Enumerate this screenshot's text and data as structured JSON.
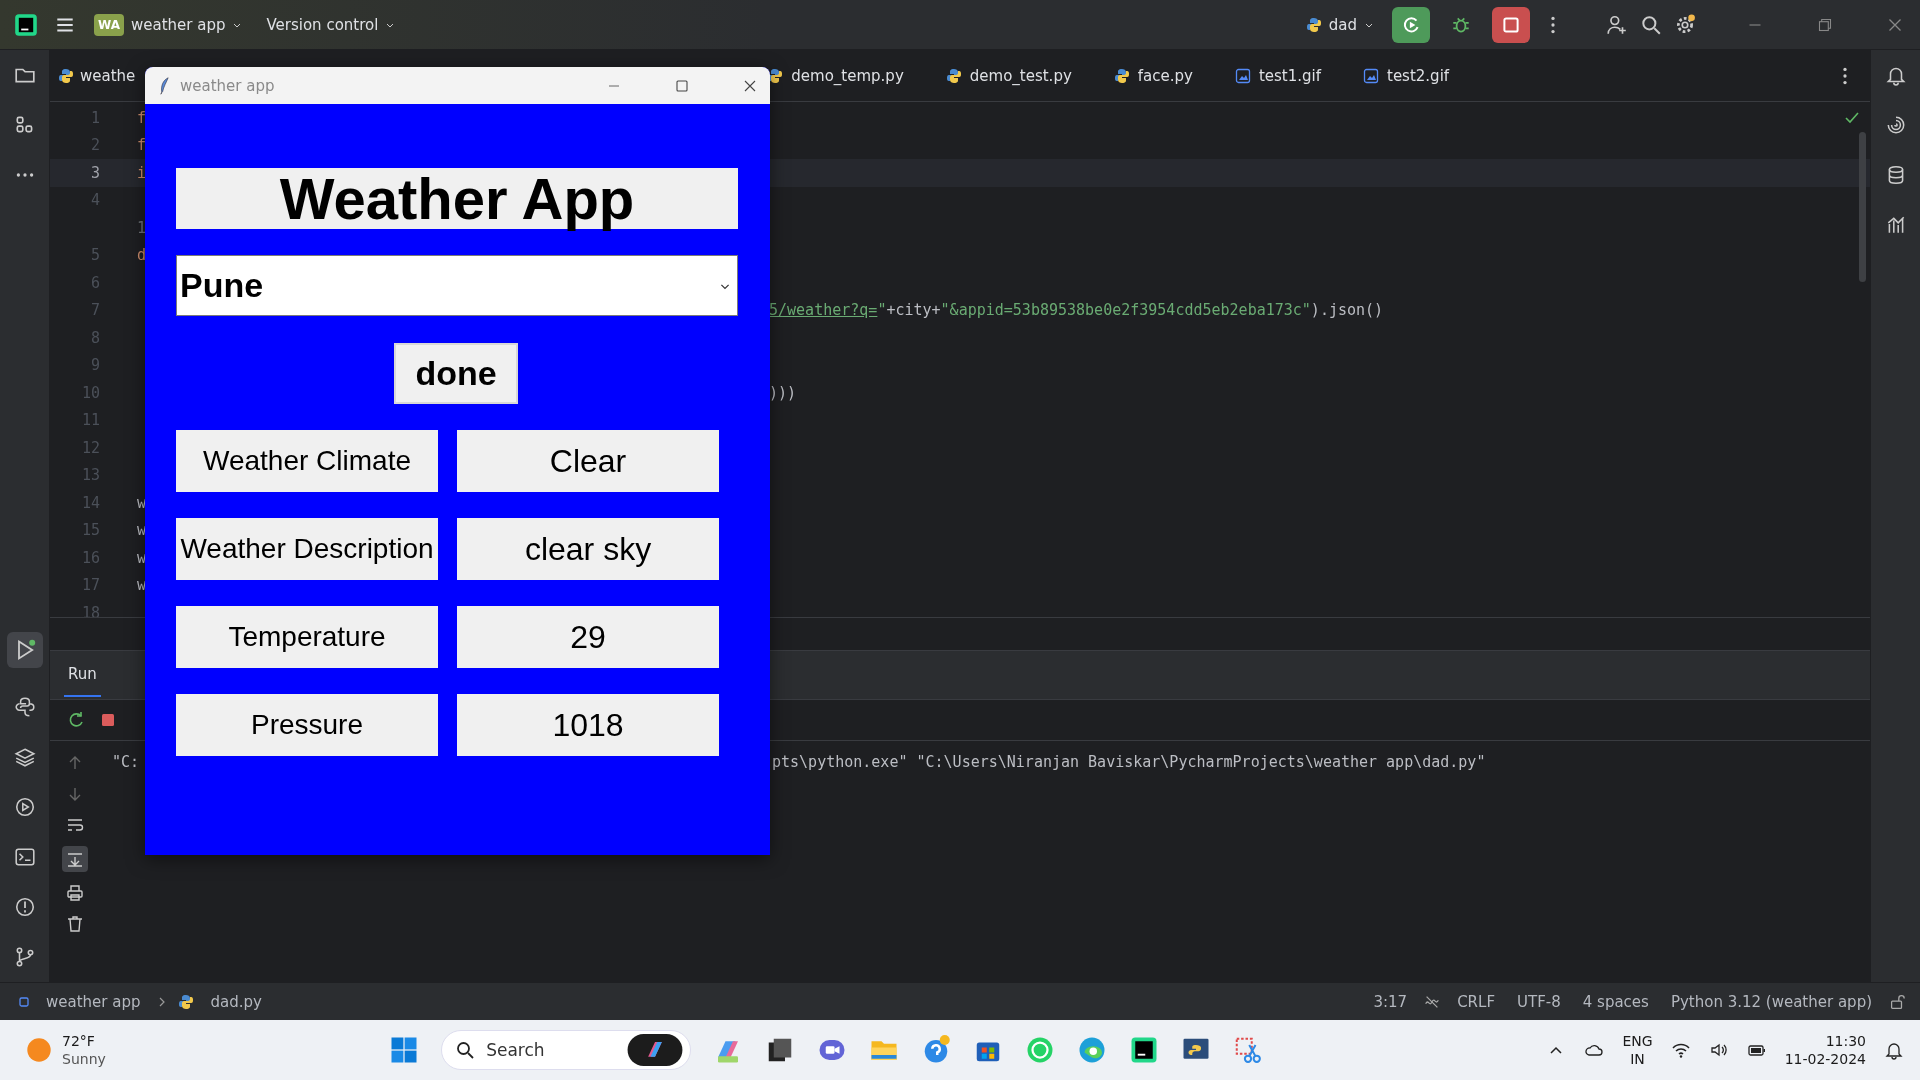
{
  "ide": {
    "project_badge": "WA",
    "project": "weather app",
    "vcs": "Version control",
    "run_config": "dad"
  },
  "tabs": [
    {
      "label": "weathe",
      "kind": "python",
      "selected": false
    },
    {
      "label": "demo_temp.py",
      "kind": "python",
      "selected": false
    },
    {
      "label": "demo_test.py",
      "kind": "python",
      "selected": false
    },
    {
      "label": "face.py",
      "kind": "python",
      "selected": false
    },
    {
      "label": "test1.gif",
      "kind": "image",
      "selected": false
    },
    {
      "label": "test2.gif",
      "kind": "image",
      "selected": false
    }
  ],
  "editor": {
    "lines": [
      {
        "number": "1",
        "left": {
          "text": "f",
          "kind": "keyword"
        },
        "selected": false
      },
      {
        "number": "2",
        "left": {
          "text": "f",
          "kind": "keyword"
        },
        "selected": false
      },
      {
        "number": "3",
        "left": {
          "text": "i",
          "kind": "keyword"
        },
        "selected": true
      },
      {
        "number": "4",
        "selected": false
      },
      {
        "left": {
          "text": "1",
          "kind": "hint"
        },
        "selected": false
      },
      {
        "number": "5",
        "left": {
          "text": "d",
          "kind": "keyword"
        },
        "selected": false
      },
      {
        "number": "6",
        "selected": false
      },
      {
        "number": "7",
        "selected": false,
        "right": [
          {
            "text": "5/weather?q=",
            "kind": "link"
          },
          {
            "text": "\"",
            "kind": "string"
          },
          {
            "text": "+city+",
            "kind": "plain"
          },
          {
            "text": "\"&appid=53b89538be0e2f3954cdd5eb2eba173c\"",
            "kind": "string"
          },
          {
            "text": ").json()",
            "kind": "plain"
          }
        ]
      },
      {
        "number": "8",
        "selected": false
      },
      {
        "number": "9",
        "selected": false
      },
      {
        "number": "10",
        "selected": false,
        "right": [
          {
            "text": ")))",
            "kind": "plain"
          }
        ]
      },
      {
        "number": "11",
        "selected": false
      },
      {
        "number": "12",
        "selected": false
      },
      {
        "number": "13",
        "selected": false
      },
      {
        "number": "14",
        "left": {
          "text": "w",
          "kind": "plain"
        },
        "selected": false
      },
      {
        "number": "15",
        "left": {
          "text": "w",
          "kind": "plain"
        },
        "selected": false
      },
      {
        "number": "16",
        "left": {
          "text": "w",
          "kind": "plain"
        },
        "selected": false
      },
      {
        "number": "17",
        "left": {
          "text": "w",
          "kind": "plain"
        },
        "selected": false
      },
      {
        "number": "18",
        "selected": false
      }
    ]
  },
  "run_panel": {
    "tab": "Run",
    "output": [
      {
        "left": "\"C:",
        "right": "pts\\python.exe\" \"C:\\Users\\Niranjan Baviskar\\PycharmProjects\\weather app\\dad.py\""
      }
    ]
  },
  "status_bar": {
    "breadcrumb": [
      "weather app",
      "dad.py"
    ],
    "position": "3:17",
    "line_separator": "CRLF",
    "encoding": "UTF-8",
    "indent": "4 spaces",
    "interpreter": "Python 3.12 (weather app)"
  },
  "tk_window": {
    "title": "weather app",
    "heading": "Weather App",
    "city": "Pune",
    "button": "done",
    "rows": [
      {
        "label": "Weather Climate",
        "value": "Clear"
      },
      {
        "label": "Weather Description",
        "value": "clear sky"
      },
      {
        "label": "Temperature",
        "value": "29"
      },
      {
        "label": "Pressure",
        "value": "1018"
      }
    ]
  },
  "taskbar": {
    "weather": {
      "temperature": "72°F",
      "condition": "Sunny"
    },
    "search": {
      "placeholder": "Search"
    },
    "language": "ENG",
    "region": "IN",
    "time": "11:30",
    "date": "11-02-2024"
  }
}
